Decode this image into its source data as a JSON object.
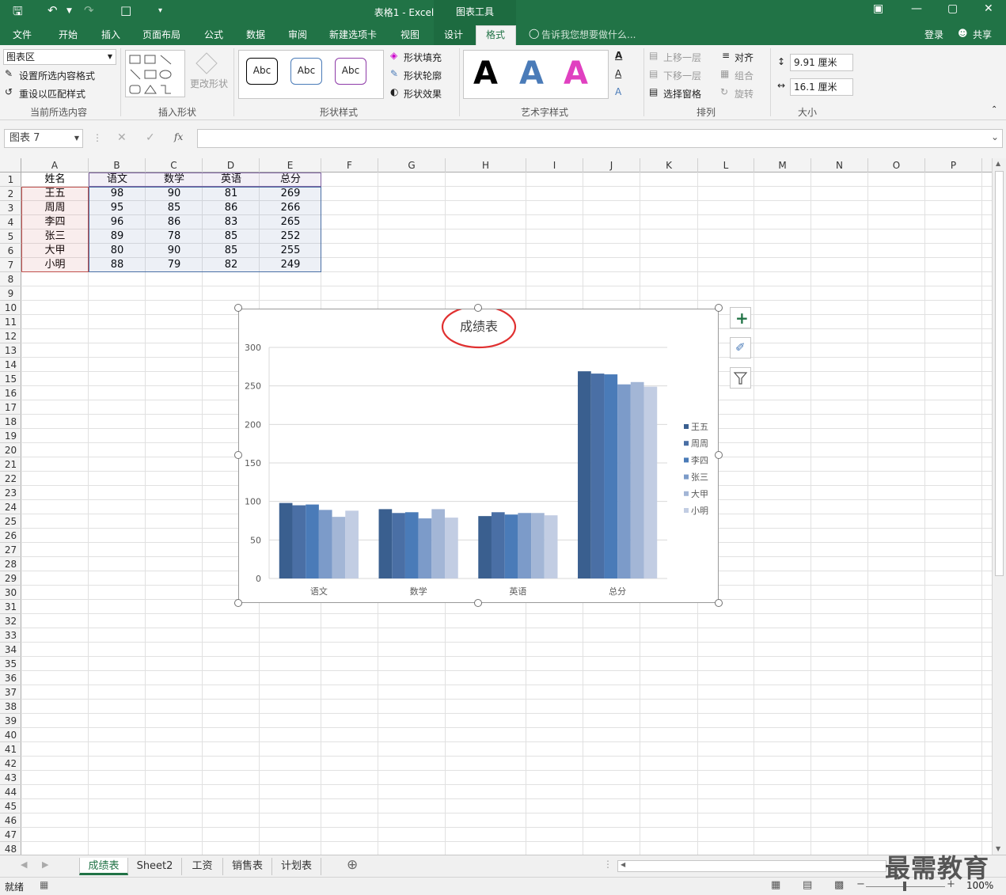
{
  "window": {
    "title": "表格1 - Excel",
    "chart_tools_label": "图表工具"
  },
  "tabs": [
    "文件",
    "开始",
    "插入",
    "页面布局",
    "公式",
    "数据",
    "审阅",
    "新建选项卡",
    "视图",
    "设计",
    "格式"
  ],
  "tell_me": "告诉我您想要做什么...",
  "login": "登录",
  "share": "共享",
  "ribbon": {
    "selection_dropdown": "图表区",
    "format_selection": "设置所选内容格式",
    "reset_style": "重设以匹配样式",
    "group_current": "当前所选内容",
    "change_shape": "更改形状",
    "group_insert_shapes": "插入形状",
    "abc": "Abc",
    "shape_fill": "形状填充",
    "shape_outline": "形状轮廓",
    "shape_effects": "形状效果",
    "group_shape_styles": "形状样式",
    "wordart_letter": "A",
    "group_wordart": "艺术字样式",
    "bring_forward": "上移一层",
    "send_backward": "下移一层",
    "selection_pane": "选择窗格",
    "align": "对齐",
    "group_obj": "组合",
    "rotate": "旋转",
    "group_arrange": "排列",
    "height": "9.91 厘米",
    "width": "16.1 厘米",
    "group_size": "大小"
  },
  "name_box": "图表 7",
  "columns": [
    "A",
    "B",
    "C",
    "D",
    "E",
    "F",
    "G",
    "H",
    "I",
    "J",
    "K",
    "L",
    "M",
    "N",
    "O",
    "P"
  ],
  "table": {
    "headers": [
      "姓名",
      "语文",
      "数学",
      "英语",
      "总分"
    ],
    "rows": [
      [
        "王五",
        "98",
        "90",
        "81",
        "269"
      ],
      [
        "周周",
        "95",
        "85",
        "86",
        "266"
      ],
      [
        "李四",
        "96",
        "86",
        "83",
        "265"
      ],
      [
        "张三",
        "89",
        "78",
        "85",
        "252"
      ],
      [
        "大甲",
        "80",
        "90",
        "85",
        "255"
      ],
      [
        "小明",
        "88",
        "79",
        "82",
        "249"
      ]
    ]
  },
  "chart_data": {
    "type": "bar",
    "title": "成绩表",
    "categories": [
      "语文",
      "数学",
      "英语",
      "总分"
    ],
    "series": [
      {
        "name": "王五",
        "values": [
          98,
          90,
          81,
          269
        ]
      },
      {
        "name": "周周",
        "values": [
          95,
          85,
          86,
          266
        ]
      },
      {
        "name": "李四",
        "values": [
          96,
          86,
          83,
          265
        ]
      },
      {
        "name": "张三",
        "values": [
          89,
          78,
          85,
          252
        ]
      },
      {
        "name": "大甲",
        "values": [
          80,
          90,
          85,
          255
        ]
      },
      {
        "name": "小明",
        "values": [
          88,
          79,
          82,
          249
        ]
      }
    ],
    "ylim": [
      0,
      300
    ],
    "yticks": [
      0,
      50,
      100,
      150,
      200,
      250,
      300
    ],
    "grid": true,
    "legend": "right",
    "colors": [
      "#3a5f8f",
      "#4a6fa5",
      "#4a7bb8",
      "#7c9bc9",
      "#a3b6d6",
      "#c2cde3"
    ]
  },
  "sheets": [
    "成绩表",
    "Sheet2",
    "工资",
    "销售表",
    "计划表"
  ],
  "status": {
    "ready": "就绪",
    "zoom": "100%"
  },
  "watermark": "最需教育",
  "colors": {
    "excel_green": "#217346",
    "title_circle": "#e03030"
  }
}
